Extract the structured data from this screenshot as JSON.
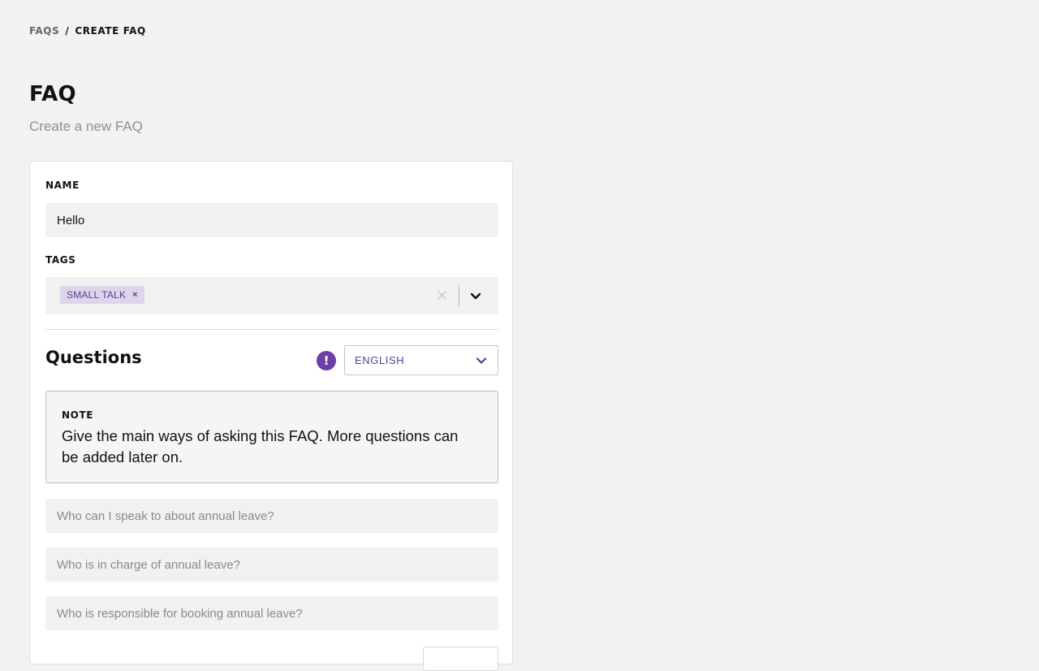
{
  "breadcrumb": {
    "parent": "FAQS",
    "separator": "/",
    "current": "CREATE FAQ"
  },
  "page": {
    "title": "FAQ",
    "subtitle": "Create a new FAQ"
  },
  "form": {
    "name": {
      "label": "NAME",
      "value": "Hello"
    },
    "tags": {
      "label": "TAGS",
      "selected": [
        "SMALL TALK"
      ],
      "remove_glyph": "×",
      "clear_glyph": "×"
    },
    "questions": {
      "heading": "Questions",
      "alert_glyph": "!",
      "language": "ENGLISH",
      "note_label": "NOTE",
      "note_text": "Give the main ways of asking this FAQ. More questions can be added later on.",
      "placeholders": [
        "Who can I speak to about annual leave?",
        "Who is in charge of annual leave?",
        "Who is responsible for booking annual leave?"
      ]
    }
  },
  "icons": {
    "tags_dropdown": "chevron-down-icon",
    "language_dropdown": "chevron-down-icon",
    "info": "alert-icon"
  },
  "colors": {
    "accent": "#6b3fa4",
    "tag_bg": "#ddd6ea",
    "tag_text": "#5a3d92",
    "page_bg": "#f2f2f2",
    "input_bg": "#f1f1f1"
  }
}
